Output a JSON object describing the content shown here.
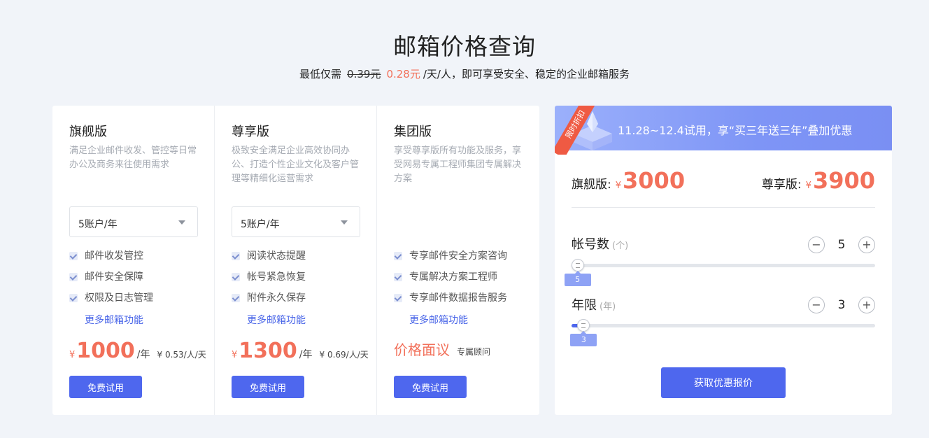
{
  "header": {
    "title": "邮箱价格查询",
    "subtitle_prefix": "最低仅需",
    "old_price": "0.39元",
    "new_price": "0.28元",
    "subtitle_suffix": "/天/人，即可享受安全、稳定的企业邮箱服务"
  },
  "plans": [
    {
      "name": "旗舰版",
      "desc": "满足企业邮件收发、管控等日常办公及商务来往使用需求",
      "select_value": "5账户/年",
      "features": [
        "邮件收发管控",
        "邮件安全保障",
        "权限及日志管理"
      ],
      "more_link": "更多邮箱功能",
      "currency": "¥",
      "price": "1000",
      "unit": "/年",
      "daily": "¥ 0.53/人/天",
      "trial_label": "免费试用"
    },
    {
      "name": "尊享版",
      "desc": "极致安全满足企业高效协同办公、打造个性企业文化及客户管理等精细化运营需求",
      "select_value": "5账户/年",
      "features": [
        "阅读状态提醒",
        "帐号紧急恢复",
        "附件永久保存"
      ],
      "more_link": "更多邮箱功能",
      "currency": "¥",
      "price": "1300",
      "unit": "/年",
      "daily": "¥ 0.69/人/天",
      "trial_label": "免费试用"
    },
    {
      "name": "集团版",
      "desc": "享受尊享版所有功能及服务，享受网易专属工程师集团专属解决方案",
      "features": [
        "专享邮件安全方案咨询",
        "专属解决方案工程师",
        "专享邮件数据报告服务"
      ],
      "more_link": "更多邮箱功能",
      "price_text": "价格面议",
      "consult": "专属顾问",
      "trial_label": "免费试用"
    }
  ],
  "calculator": {
    "ribbon": "限时折扣",
    "banner": "11.28~12.4试用，享“买三年送三年”叠加优惠",
    "tiers": [
      {
        "label": "旗舰版:",
        "currency": "¥",
        "amount": "3000"
      },
      {
        "label": "尊享版:",
        "currency": "¥",
        "amount": "3900"
      }
    ],
    "accounts": {
      "label": "帐号数",
      "unit": "(个)",
      "value": "5",
      "fraction": 0.02,
      "bubble": "5"
    },
    "years": {
      "label": "年限",
      "unit": "(年)",
      "value": "3",
      "fraction": 0.04,
      "bubble": "3"
    },
    "minus_symbol": "−",
    "plus_symbol": "+",
    "quote_label": "获取优惠报价"
  },
  "colors": {
    "accent": "#4e67ee",
    "price": "#f2705a",
    "banner": "#8ea2f5"
  }
}
